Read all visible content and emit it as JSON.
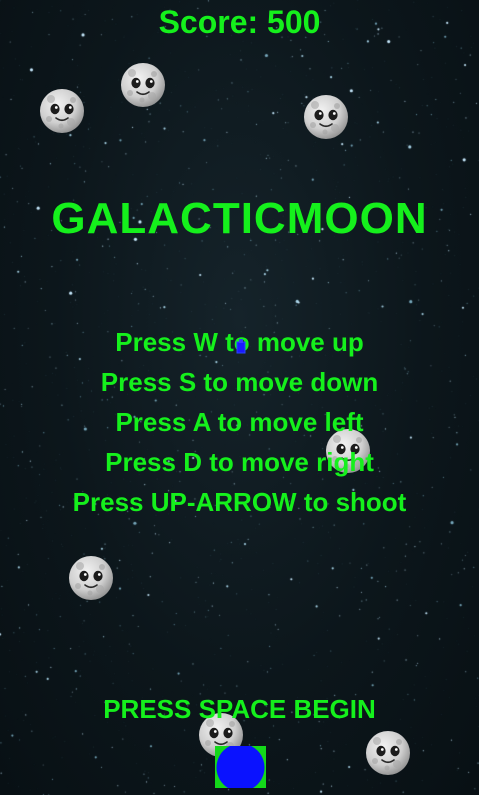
{
  "game": {
    "score_text": "Score: 500",
    "title": "GALACTICMOON",
    "instructions": [
      "Press W to move up",
      "Press S to move down",
      "Press A to move left",
      "Press D to move right",
      "Press UP-ARROW to shoot"
    ],
    "start_prompt": "PRESS SPACE BEGIN"
  },
  "colors": {
    "text": "#15f01c",
    "background": "#0c161b",
    "player_body": "#0a12ff",
    "player_frame": "#14d81a",
    "bullet": "#1a1aff",
    "moon": "#d8d8d8"
  },
  "icons": {
    "enemy": "moon-face-icon",
    "player": "blue-ball-ship-icon",
    "projectile": "bullet-icon"
  }
}
